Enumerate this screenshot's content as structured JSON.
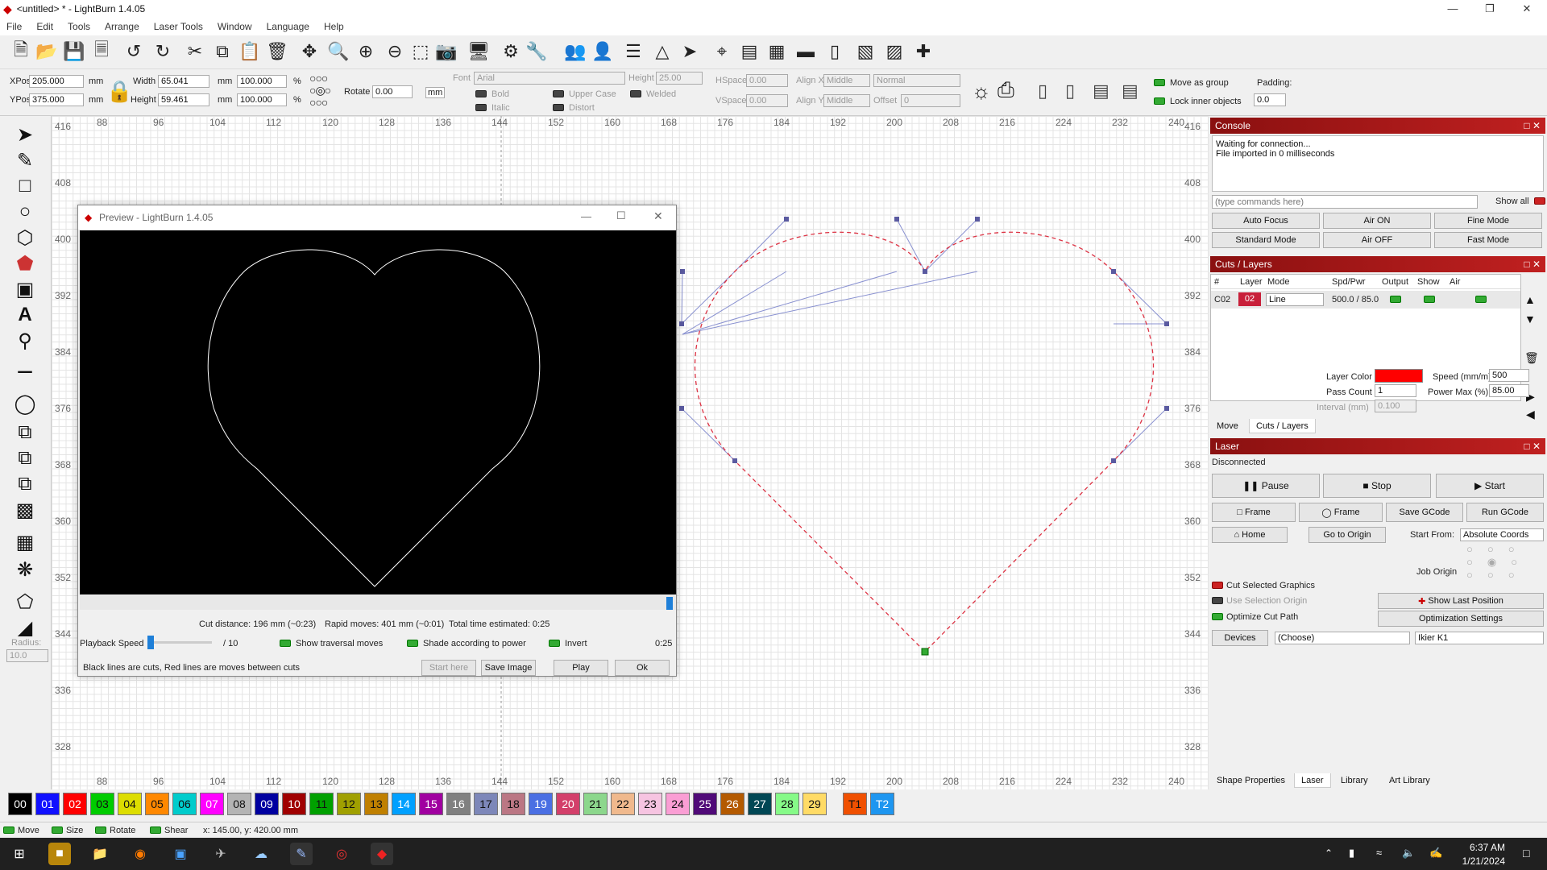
{
  "window": {
    "title": "<untitled> * - LightBurn 1.4.05"
  },
  "menu": [
    "File",
    "Edit",
    "Tools",
    "Arrange",
    "Laser Tools",
    "Window",
    "Language",
    "Help"
  ],
  "props": {
    "xpos_label": "XPos",
    "xpos": "205.000",
    "ypos_label": "YPos",
    "ypos": "375.000",
    "unit": "mm",
    "width_label": "Width",
    "width": "65.041",
    "height_label": "Height",
    "height": "59.461",
    "wpct": "100.000",
    "hpct": "100.000",
    "pct": "%",
    "rotate_label": "Rotate",
    "rotate": "0.00",
    "font_label": "Font",
    "font": "Arial",
    "fheight_label": "Height",
    "fheight": "25.00",
    "hspace_label": "HSpace",
    "hspace": "0.00",
    "vspace_label": "VSpace",
    "vspace": "0.00",
    "alignx_label": "Align X",
    "alignx": "Middle",
    "aligny_label": "Align Y",
    "aligny": "Middle",
    "normal": "Normal",
    "offset_label": "Offset",
    "offset": "0",
    "bold": "Bold",
    "italic": "Italic",
    "uppercase": "Upper Case",
    "distort": "Distort",
    "welded": "Welded",
    "move_group": "Move as group",
    "lock_inner": "Lock inner objects",
    "padding_label": "Padding:",
    "padding": "0.0"
  },
  "rulers": {
    "top": [
      "88",
      "96",
      "104",
      "112",
      "120",
      "128",
      "136",
      "144",
      "152",
      "160",
      "168",
      "176",
      "184",
      "192",
      "200",
      "208",
      "216",
      "224",
      "232",
      "240"
    ],
    "left": [
      "416",
      "408",
      "400",
      "392",
      "384",
      "376",
      "368",
      "360",
      "352",
      "344",
      "336",
      "328"
    ]
  },
  "preview": {
    "title": "Preview - LightBurn 1.4.05",
    "cut_distance": "Cut distance: 196 mm (~0:23)",
    "rapid": "Rapid moves: 401 mm (~0:01)",
    "total": "Total time estimated: 0:25",
    "speed_label": "Playback Speed",
    "speed_max": "/ 10",
    "show_traversal": "Show traversal moves",
    "shade": "Shade according to power",
    "invert": "Invert",
    "time": "0:25",
    "note": "Black lines are cuts, Red lines are moves between cuts",
    "start_here": "Start here",
    "save_image": "Save Image",
    "play": "Play",
    "ok": "Ok"
  },
  "console": {
    "title": "Console",
    "lines": [
      "Waiting for connection...",
      "File imported in 0 milliseconds"
    ],
    "placeholder": "(type commands here)",
    "show_all": "Show all",
    "buttons": [
      "Auto Focus",
      "Air ON",
      "Fine Mode",
      "Standard Mode",
      "Air OFF",
      "Fast Mode"
    ]
  },
  "cuts": {
    "title": "Cuts / Layers",
    "headers": [
      "#",
      "Layer",
      "Mode",
      "Spd/Pwr",
      "Output",
      "Show",
      "Air"
    ],
    "row": {
      "num": "C02",
      "layer": "02",
      "mode": "Line",
      "spdpwr": "500.0 / 85.0"
    },
    "layer_color_label": "Layer Color",
    "speed_label": "Speed (mm/m)",
    "speed": "500",
    "pass_label": "Pass Count",
    "pass": "1",
    "power_label": "Power Max (%)",
    "power": "85.00",
    "interval_label": "Interval (mm)",
    "interval": "0.100",
    "tabs": [
      "Move",
      "Cuts / Layers"
    ]
  },
  "laser": {
    "title": "Laser",
    "status": "Disconnected",
    "pause": "Pause",
    "stop": "Stop",
    "start": "Start",
    "frame1": "Frame",
    "frame2": "Frame",
    "save_gcode": "Save GCode",
    "run_gcode": "Run GCode",
    "home": "Home",
    "go_origin": "Go to Origin",
    "start_from_label": "Start From:",
    "start_from": "Absolute Coords",
    "job_origin": "Job Origin",
    "cut_selected": "Cut Selected Graphics",
    "use_sel_origin": "Use Selection Origin",
    "optimize": "Optimize Cut Path",
    "show_last": "Show Last Position",
    "opt_settings": "Optimization Settings",
    "devices": "Devices",
    "choose": "(Choose)",
    "device": "Ikier K1"
  },
  "bottom_tabs": [
    "Shape Properties",
    "Laser",
    "Library",
    "Art Library"
  ],
  "palette": [
    {
      "l": "00",
      "c": "#000000",
      "t": "#ffffff"
    },
    {
      "l": "01",
      "c": "#1010ff",
      "t": "#ffffff"
    },
    {
      "l": "02",
      "c": "#ff0000",
      "t": "#ffffff"
    },
    {
      "l": "03",
      "c": "#00cc00",
      "t": "#111111"
    },
    {
      "l": "04",
      "c": "#dddd00",
      "t": "#111111"
    },
    {
      "l": "05",
      "c": "#ff8800",
      "t": "#111111"
    },
    {
      "l": "06",
      "c": "#00cccc",
      "t": "#111111"
    },
    {
      "l": "07",
      "c": "#ff00ff",
      "t": "#ffffff"
    },
    {
      "l": "08",
      "c": "#b4b4b4",
      "t": "#111111"
    },
    {
      "l": "09",
      "c": "#0000a0",
      "t": "#ffffff"
    },
    {
      "l": "10",
      "c": "#a00000",
      "t": "#ffffff"
    },
    {
      "l": "11",
      "c": "#00a000",
      "t": "#111111"
    },
    {
      "l": "12",
      "c": "#a0a000",
      "t": "#111111"
    },
    {
      "l": "13",
      "c": "#c08000",
      "t": "#111111"
    },
    {
      "l": "14",
      "c": "#00a0ff",
      "t": "#ffffff"
    },
    {
      "l": "15",
      "c": "#a000a0",
      "t": "#ffffff"
    },
    {
      "l": "16",
      "c": "#808080",
      "t": "#ffffff"
    },
    {
      "l": "17",
      "c": "#7d87b9",
      "t": "#111111"
    },
    {
      "l": "18",
      "c": "#bb7784",
      "t": "#111111"
    },
    {
      "l": "19",
      "c": "#4a6fe3",
      "t": "#ffffff"
    },
    {
      "l": "20",
      "c": "#d33f6a",
      "t": "#ffffff"
    },
    {
      "l": "21",
      "c": "#8cd78c",
      "t": "#111111"
    },
    {
      "l": "22",
      "c": "#f0b98d",
      "t": "#111111"
    },
    {
      "l": "23",
      "c": "#f6c4e1",
      "t": "#111111"
    },
    {
      "l": "24",
      "c": "#fa9ed4",
      "t": "#111111"
    },
    {
      "l": "25",
      "c": "#500a78",
      "t": "#ffffff"
    },
    {
      "l": "26",
      "c": "#b45a00",
      "t": "#ffffff"
    },
    {
      "l": "27",
      "c": "#004754",
      "t": "#ffffff"
    },
    {
      "l": "28",
      "c": "#86fa88",
      "t": "#111111"
    },
    {
      "l": "29",
      "c": "#ffdb66",
      "t": "#111111"
    },
    {
      "l": "T1",
      "c": "#f05000",
      "t": "#111111"
    },
    {
      "l": "T2",
      "c": "#1e96f0",
      "t": "#ffffff"
    }
  ],
  "statusbar": {
    "move": "Move",
    "size": "Size",
    "rotate": "Rotate",
    "shear": "Shear",
    "coords": "x: 145.00, y: 420.00 mm"
  },
  "leftbar": {
    "radius_label": "Radius:",
    "radius": "10.0"
  },
  "clock": {
    "time": "6:37 AM",
    "date": "1/21/2024"
  }
}
